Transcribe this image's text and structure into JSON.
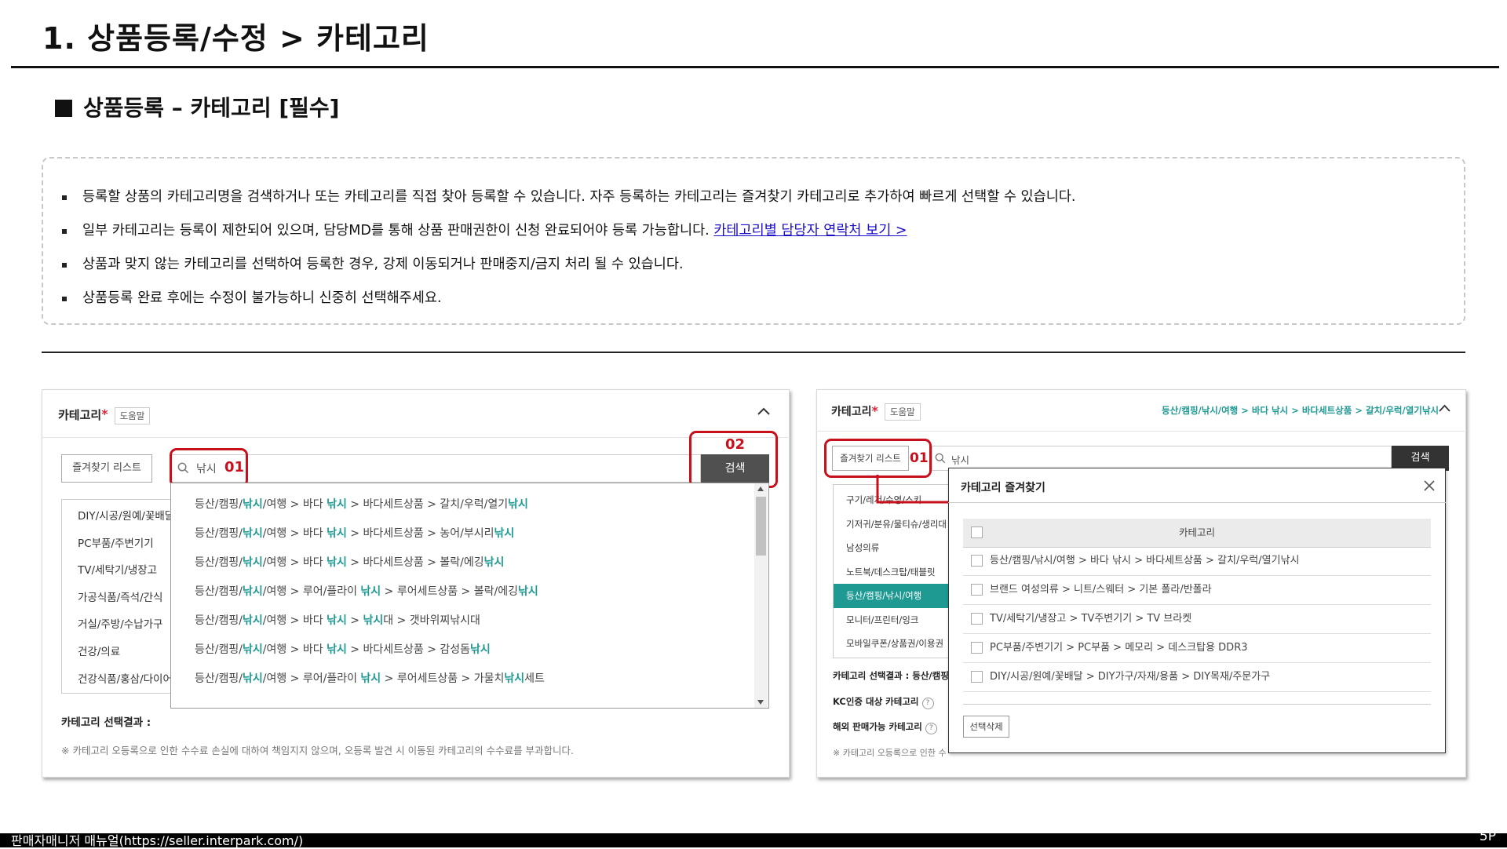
{
  "page": {
    "title": "1. 상품등록/수정 > 카테고리",
    "section_title": "상품등록 – 카테고리 [필수]"
  },
  "notices": [
    {
      "text": "등록할 상품의 카테고리명을 검색하거나 또는 카테고리를 직접 찾아 등록할 수 있습니다. 자주 등록하는 카테고리는 즐겨찾기 카테고리로 추가하여 빠르게 선택할 수 있습니다.",
      "link": ""
    },
    {
      "text": "일부 카테고리는 등록이 제한되어 있으며, 담당MD를 통해 상품 판매권한이 신청 완료되어야 등록 가능합니다. ",
      "link": "카테고리별 담당자 연락처 보기 >"
    },
    {
      "text": "상품과 맞지 않는 카테고리를 선택하여 등록한 경우, 강제 이동되거나 판매중지/금지 처리 될 수 있습니다.",
      "link": ""
    },
    {
      "text": "상품등록 완료 후에는 수정이 불가능하니 신중히 선택해주세요.",
      "link": ""
    }
  ],
  "left": {
    "label": "카테고리",
    "required": "*",
    "help": "도움말",
    "fav_button": "즐겨찾기 리스트",
    "search_value": "낚시",
    "search_button": "검색",
    "marker_01": "01",
    "marker_02": "02",
    "categories": [
      "DIY/시공/원예/꽃배달",
      "PC부품/주변기기",
      "TV/세탁기/냉장고",
      "가공식품/즉석/간식",
      "거실/주방/수납가구",
      "건강/의료",
      "건강식품/홍삼/다이어트"
    ],
    "suggestions": [
      [
        "등산/캠핑/",
        "낚시",
        "/여행 > 바다 ",
        "낚시",
        " > 바다세트상품 > 갈치/우럭/열기",
        "낚시",
        ""
      ],
      [
        "등산/캠핑/",
        "낚시",
        "/여행 > 바다 ",
        "낚시",
        " > 바다세트상품 > 농어/부시리",
        "낚시",
        ""
      ],
      [
        "등산/캠핑/",
        "낚시",
        "/여행 > 바다 ",
        "낚시",
        " > 바다세트상품 > 볼락/에깅",
        "낚시",
        ""
      ],
      [
        "등산/캠핑/",
        "낚시",
        "/여행 > 루어/플라이 ",
        "낚시",
        " > 루어세트상품 > 볼락/에깅",
        "낚시",
        ""
      ],
      [
        "등산/캠핑/",
        "낚시",
        "/여행 > 바다 ",
        "낚시",
        " > ",
        "낚시",
        "대 > 갯바위찌낚시대"
      ],
      [
        "등산/캠핑/",
        "낚시",
        "/여행 > 바다 ",
        "낚시",
        " > 바다세트상품 > 감성돔",
        "낚시",
        ""
      ],
      [
        "등산/캠핑/",
        "낚시",
        "/여행 > 루어/플라이 ",
        "낚시",
        " > 루어세트상품 > 가물치",
        "낚시",
        "세트"
      ]
    ],
    "result_label": "카테고리 선택결과 :",
    "note": "※ 카테고리 오등록으로 인한 수수료 손실에 대하여 책임지지 않으며, 오등록 발견 시 이동된 카테고리의 수수료를 부과합니다."
  },
  "right": {
    "label": "카테고리",
    "required": "*",
    "help": "도움말",
    "path": "등산/캠핑/낚시/여행 > 바다 낚시 > 바다세트상품 > 갈치/우럭/열기낚시",
    "fav_button": "즐겨찾기 리스트",
    "marker_01": "01",
    "search_value": "낚시",
    "search_button": "검색",
    "categories": [
      "구기/레저/수영/스키",
      "기저귀/분유/물티슈/생리대",
      "남성의류",
      "노트북/데스크탑/태블릿",
      "등산/캠핑/낚시/여행",
      "모니터/프린터/잉크",
      "모바일쿠폰/상품권/이용권"
    ],
    "selected_index": 4,
    "result_label": "카테고리 선택결과 : 등산/캠핑",
    "kc_label": "KC인증 대상 카테고리",
    "overseas_label": "해외 판매가능 카테고리",
    "note": "※ 카테고리 오등록으로 인한 수",
    "modal": {
      "title": "카테고리 즐겨찾기",
      "header": "카테고리",
      "rows": [
        "등산/캠핑/낚시/여행 > 바다 낚시 > 바다세트상품 > 갈치/우럭/열기낚시",
        "브랜드 여성의류 > 니트/스웨터 > 기본 폴라/반폴라",
        "TV/세탁기/냉장고 > TV주변기기 > TV 브라켓",
        "PC부품/주변기기 > PC부품 > 메모리 > 데스크탑용 DDR3",
        "DIY/시공/원예/꽃배달 > DIY가구/자재/용품 > DIY목재/주문가구"
      ],
      "delete_button": "선택삭제"
    }
  },
  "footer": {
    "text": "판매자매니저 매뉴얼(https://seller.interpark.com/)",
    "page": "5P"
  },
  "colors": {
    "accent_red": "#c8101c",
    "teal": "#1e9a93",
    "link": "#1a0dcc"
  }
}
